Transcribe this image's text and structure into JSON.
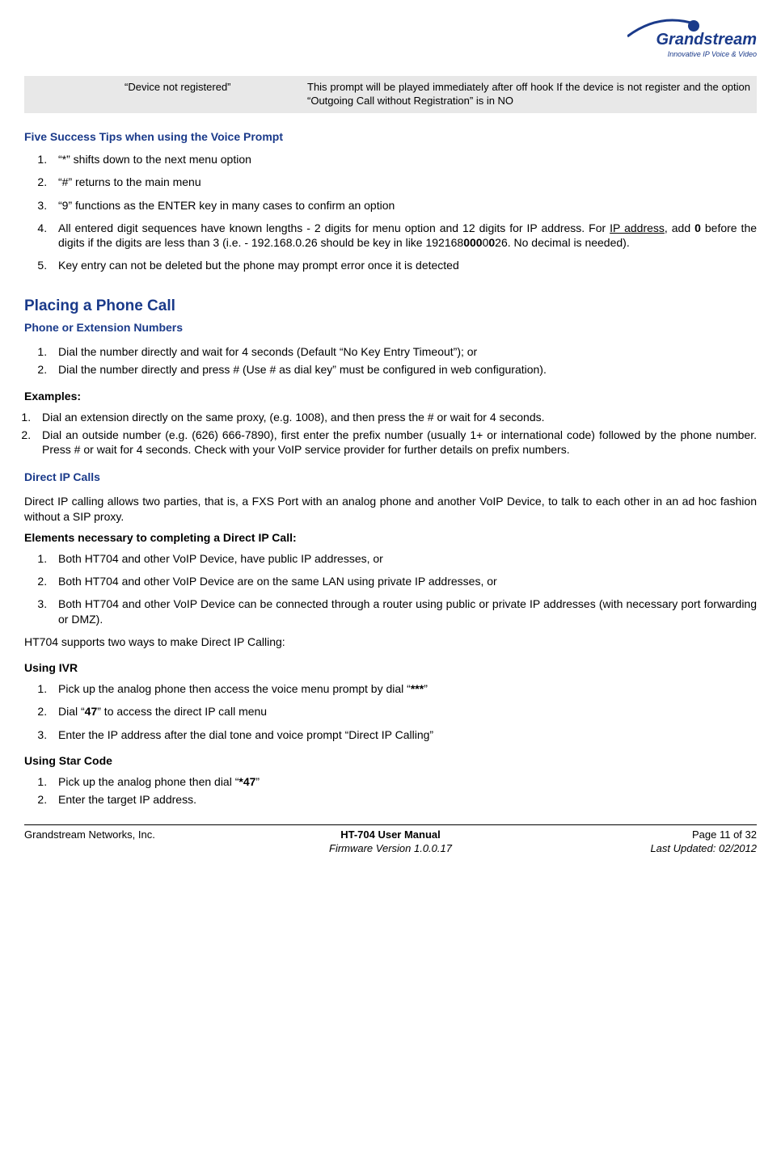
{
  "logo": {
    "brand": "Grandstream",
    "tagline": "Innovative IP Voice & Video"
  },
  "table": {
    "col2": "“Device not registered”",
    "col3": "This prompt will be played immediately after off hook If the device is not register and the option “Outgoing Call without Registration” is in NO"
  },
  "h_five_tips": "Five Success Tips when using the Voice Prompt",
  "tips": {
    "t1": "“*” shifts down to the next menu option",
    "t2": "“#” returns to the main menu",
    "t3": "“9” functions as the ENTER key in many cases to confirm an option",
    "t4_a": "All entered digit sequences have known lengths - 2 digits for menu option and 12 digits for IP address. For ",
    "t4_ip": "IP address",
    "t4_b": ", add ",
    "t4_zero": "0",
    "t4_c": " before the digits if the digits are less than 3 (i.e. - 192.168.0.26 should be key in like 192168",
    "t4_zeros1": "000",
    "t4_d": "0",
    "t4_zeros2": "0",
    "t4_e": "26.  No decimal is needed).",
    "t5": "Key entry can not be deleted but the phone may prompt error once it is detected"
  },
  "h_placing": "Placing a Phone Call",
  "h_phone_ext": "Phone or Extension Numbers",
  "phone_ext": {
    "l1": "Dial the number directly and wait for 4 seconds (Default “No Key Entry Timeout”);  or",
    "l2": "Dial the number directly and press # (Use # as dial key” must be configured in web configuration)."
  },
  "h_examples": "Examples:",
  "examples": {
    "l1": "Dial an extension directly on the same proxy, (e.g. 1008), and then press the # or wait for 4 seconds.",
    "l2": "Dial an outside number (e.g. (626) 666-7890), first enter the prefix number (usually 1+ or international code) followed by the phone number.  Press # or wait for 4 seconds.  Check with your VoIP service provider for further details on prefix numbers."
  },
  "h_direct_ip": "Direct IP Calls",
  "direct_ip_intro": "Direct IP calling allows two parties, that is, a FXS Port with an analog phone and another VoIP Device, to talk to each other in an ad hoc fashion without a SIP proxy.",
  "h_elements": "Elements necessary to completing a Direct IP Call:",
  "elements": {
    "l1": "Both HT704 and other VoIP Device, have public IP addresses, or",
    "l2": "Both HT704 and other VoIP Device are on the same LAN using private IP addresses, or",
    "l3": "Both HT704 and other VoIP Device can be connected through a router using public or private IP addresses (with necessary port forwarding or DMZ)."
  },
  "two_ways": "HT704 supports two ways to make Direct IP Calling:",
  "h_ivr": "Using IVR",
  "ivr": {
    "l1_a": "Pick up the analog phone then access the voice menu prompt by dial “",
    "l1_b": "***",
    "l1_c": "”",
    "l2_a": "Dial “",
    "l2_b": "47",
    "l2_c": "” to access the direct IP call menu",
    "l3": "Enter the IP address after the dial tone and voice prompt “Direct IP Calling”"
  },
  "h_star": "Using Star Code",
  "star": {
    "l1_a": "Pick up the analog phone then dial “",
    "l1_b": "*47",
    "l1_c": "”",
    "l2": "Enter the target IP address."
  },
  "footer": {
    "left": "Grandstream Networks, Inc.",
    "center1": "HT-704 User Manual",
    "center2": "Firmware Version 1.0.0.17",
    "right1": "Page 11 of 32",
    "right2": "Last Updated: 02/2012"
  }
}
